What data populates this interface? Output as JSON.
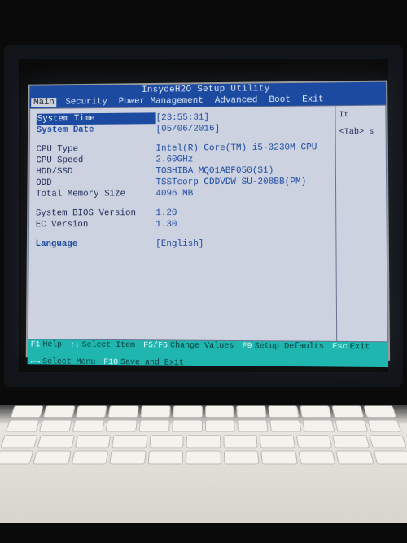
{
  "title": "InsydeH2O Setup Utility",
  "menu": {
    "items": [
      "Main",
      "Security",
      "Power Management",
      "Advanced",
      "Boot",
      "Exit"
    ],
    "active": 0
  },
  "rows": [
    {
      "label": "System Time",
      "value": "[23:55:31]",
      "highlight": true
    },
    {
      "label": "System Date",
      "value": "[05/06/2016]",
      "selected": true
    }
  ],
  "info": [
    {
      "label": "CPU Type",
      "value": "Intel(R) Core(TM) i5-3230M CPU"
    },
    {
      "label": "CPU Speed",
      "value": "2.60GHz"
    },
    {
      "label": "HDD/SSD",
      "value": "TOSHIBA MQ01ABF050(S1)"
    },
    {
      "label": "ODD",
      "value": "TSSTcorp CDDVDW SU-208BB(PM)"
    },
    {
      "label": "Total Memory Size",
      "value": "4096 MB"
    }
  ],
  "versions": [
    {
      "label": "System BIOS Version",
      "value": "1.20"
    },
    {
      "label": "EC Version",
      "value": "1.30"
    }
  ],
  "language": {
    "label": "Language",
    "value": "[English]"
  },
  "help": {
    "title": "It",
    "text": "<Tab> s"
  },
  "footer": {
    "f1": "Help",
    "arrows": "Select Item",
    "f56": "Change Values",
    "f9": "Setup Defaults",
    "esc": "Exit",
    "arrows2": "Select Menu",
    "enter": "",
    "f10": "Save and Exit"
  }
}
